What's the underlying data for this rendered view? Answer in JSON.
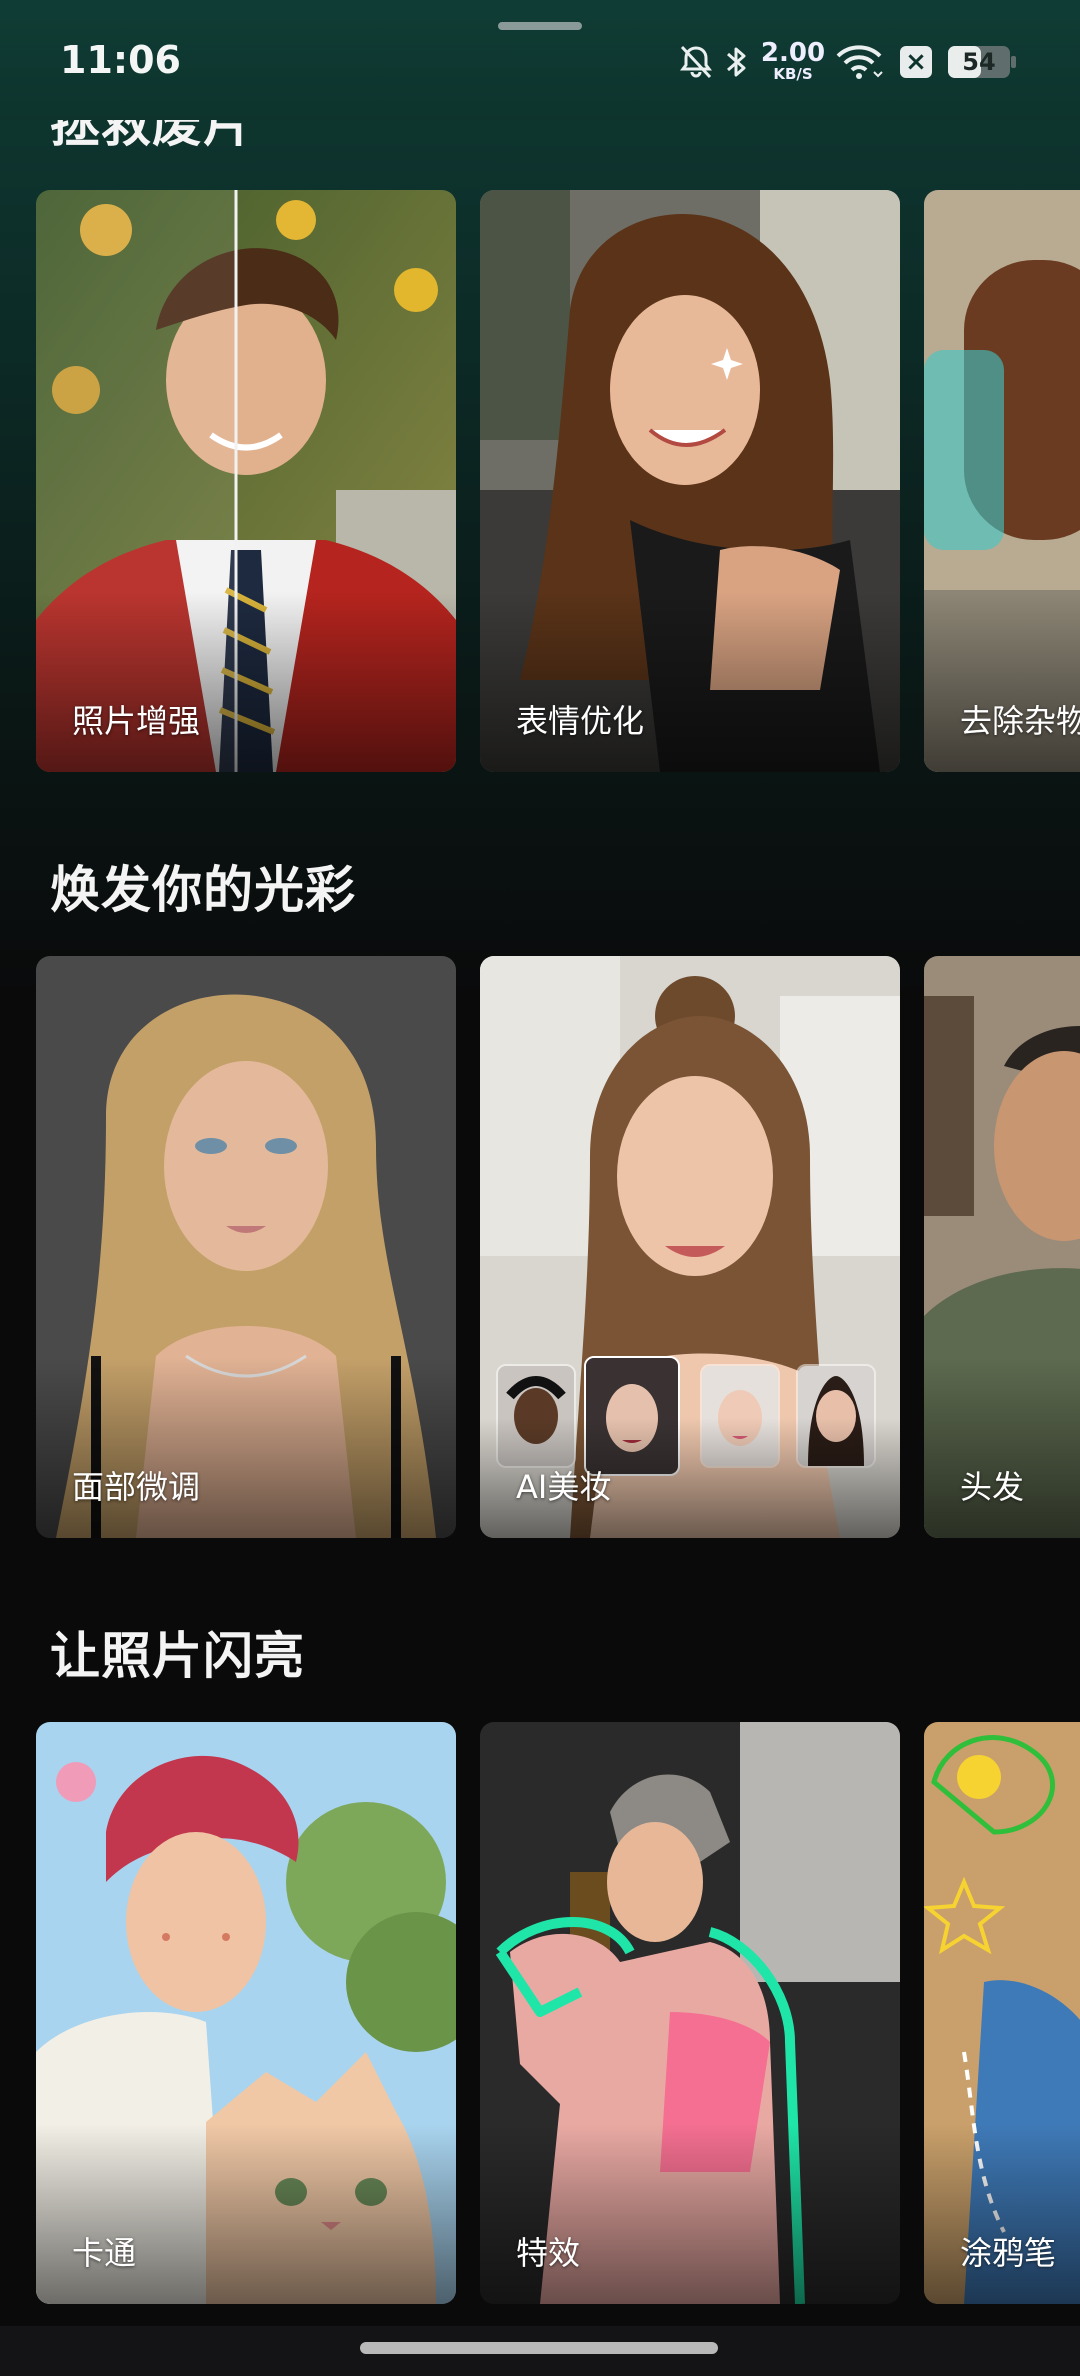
{
  "status_bar": {
    "time": "11:06",
    "net_speed_value": "2.00",
    "net_speed_unit": "KB/S",
    "battery_level": "54",
    "battery_fraction": 0.54,
    "icons": [
      "bell-muted-icon",
      "bluetooth-icon",
      "wifi-icon",
      "close-box-icon",
      "battery-icon"
    ]
  },
  "sections": [
    {
      "title": "拯救废片",
      "cards": [
        {
          "label": "照片增强"
        },
        {
          "label": "表情优化"
        },
        {
          "label": "去除杂物"
        }
      ]
    },
    {
      "title": "焕发你的光彩",
      "cards": [
        {
          "label": "面部微调"
        },
        {
          "label": "AI美妆"
        },
        {
          "label": "头发"
        }
      ]
    },
    {
      "title": "让照片闪亮",
      "cards": [
        {
          "label": "卡通"
        },
        {
          "label": "特效"
        },
        {
          "label": "涂鸦笔"
        }
      ]
    }
  ],
  "colors": {
    "background": "#0a0a0b",
    "header_tint": "#0f3d35",
    "outline_accent": "#28e0a8"
  }
}
